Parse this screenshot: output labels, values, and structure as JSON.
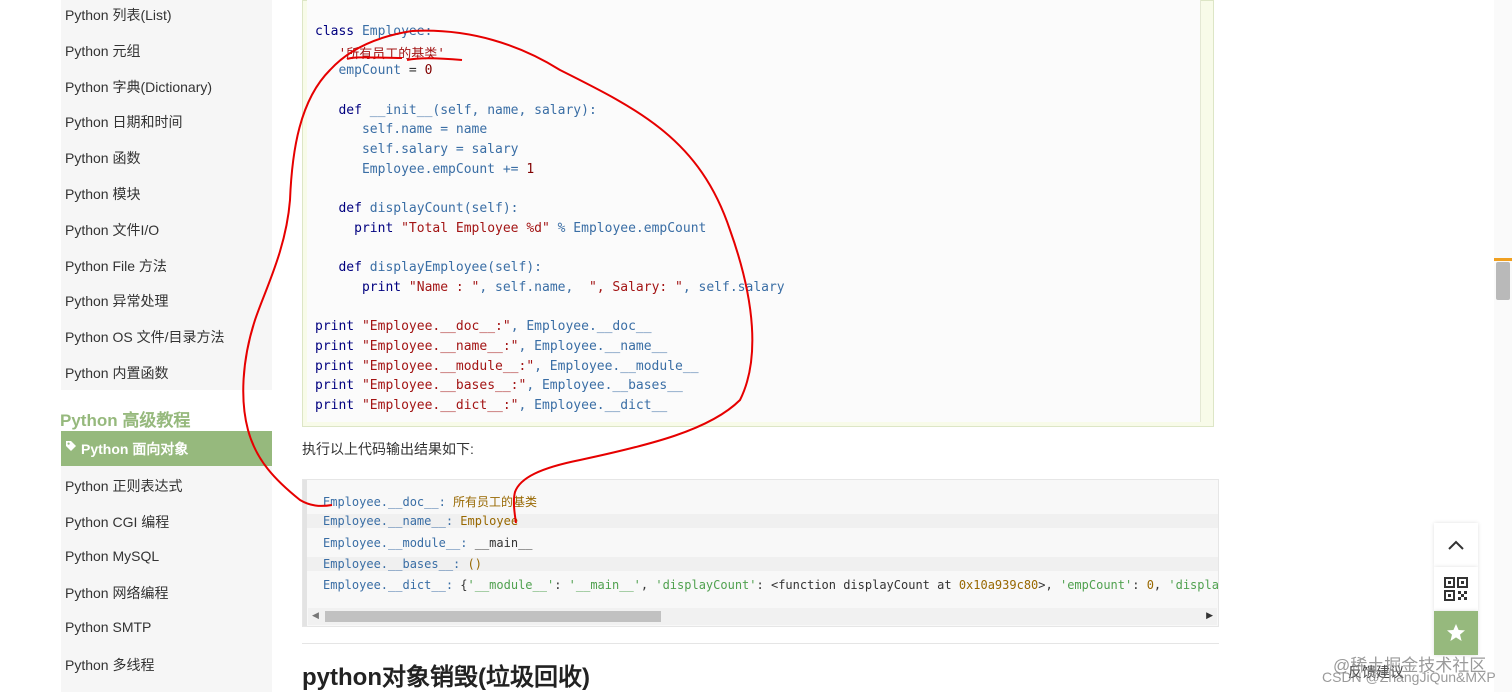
{
  "sidebar": {
    "items": [
      "Python 列表(List)",
      "Python 元组",
      "Python 字典(Dictionary)",
      "Python 日期和时间",
      "Python 函数",
      "Python 模块",
      "Python 文件I/O",
      "Python File 方法",
      "Python 异常处理",
      "Python OS 文件/目录方法",
      "Python 内置函数"
    ],
    "section_heading": "Python 高级教程",
    "active_item": "Python 面向对象",
    "items_after": [
      "Python 正则表达式",
      "Python CGI 编程",
      "Python MySQL",
      "Python 网络编程",
      "Python SMTP",
      "Python 多线程"
    ]
  },
  "code": {
    "l1_kw": "class",
    "l1_id": " Employee:",
    "l2": "   '所有员工的基类'",
    "l3_id": "   empCount",
    "l3_op": " = ",
    "l3_num": "0",
    "l5_kw": "   def",
    "l5_rest": " __init__(self, name, salary):",
    "l6": "      self.name = name",
    "l7": "      self.salary = salary",
    "l8_id": "      Employee.empCount += ",
    "l8_num": "1",
    "l10_kw": "   def",
    "l10_rest": " displayCount(self):",
    "l11_kw": "     print",
    "l11_str": " \"Total Employee %d\"",
    "l11_rest": " % Employee.empCount",
    "l13_kw": "   def",
    "l13_rest": " displayEmployee(self):",
    "l14_kw": "      print",
    "l14_s1": " \"Name : \"",
    "l14_r1": ", self.name, ",
    "l14_s2": " \", Salary: \"",
    "l14_r2": ", self.salary",
    "l16_kw": "print",
    "l16_str": " \"Employee.__doc__:\"",
    "l16_rest": ", Employee.__doc__",
    "l17_kw": "print",
    "l17_str": " \"Employee.__name__:\"",
    "l17_rest": ", Employee.__name__",
    "l18_kw": "print",
    "l18_str": " \"Employee.__module__:\"",
    "l18_rest": ", Employee.__module__",
    "l19_kw": "print",
    "l19_str": " \"Employee.__bases__:\"",
    "l19_rest": ", Employee.__bases__",
    "l20_kw": "print",
    "l20_str": " \"Employee.__dict__:\"",
    "l20_rest": ", Employee.__dict__"
  },
  "exec_text": "执行以上代码输出结果如下:",
  "output": {
    "o1_key": "Employee.__doc__:",
    "o1_val": " 所有员工的基类",
    "o2_key": "Employee.__name__:",
    "o2_val": " Employee",
    "o3_key": "Employee.__module__:",
    "o3_val": " __main__",
    "o4_key": "Employee.__bases__:",
    "o4_val": " ()",
    "o5_key": "Employee.__dict__:",
    "o5_a": " {",
    "o5_s1": "'__module__'",
    "o5_b": ": ",
    "o5_s2": "'__main__'",
    "o5_c": ", ",
    "o5_s3": "'displayCount'",
    "o5_d": ": <function displayCount at ",
    "o5_n1": "0x10a939c80",
    "o5_e": ">, ",
    "o5_s4": "'empCount'",
    "o5_f": ": ",
    "o5_n2": "0",
    "o5_g": ", ",
    "o5_s5": "'displa"
  },
  "section_heading": "python对象销毁(垃圾回收)",
  "floating": {
    "feedback": "反馈建议",
    "watermark_1": "@稀土掘金技术社区",
    "watermark_2": "CSDN @ZhangJiQun&MXP"
  },
  "colors": {
    "accent": "#96b97d",
    "annotation": "#e60000"
  }
}
